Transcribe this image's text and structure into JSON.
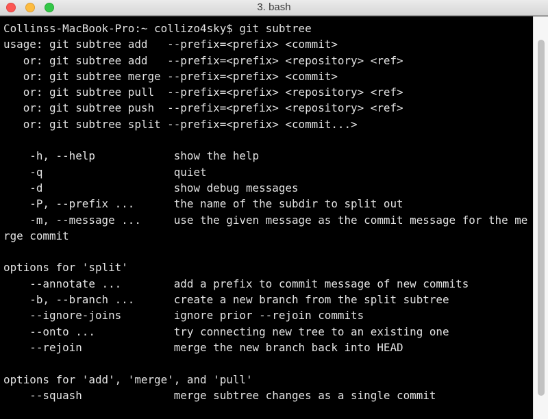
{
  "window": {
    "title": "3. bash",
    "buttons": [
      {
        "name": "close",
        "color": "#fc5753"
      },
      {
        "name": "minimize",
        "color": "#fdbc40"
      },
      {
        "name": "zoom",
        "color": "#33c748"
      }
    ]
  },
  "terminal": {
    "background": "#000000",
    "foreground": "#e2e2e2",
    "lines": [
      "Collinss-MacBook-Pro:~ collizo4sky$ git subtree",
      "usage: git subtree add   --prefix=<prefix> <commit>",
      "   or: git subtree add   --prefix=<prefix> <repository> <ref>",
      "   or: git subtree merge --prefix=<prefix> <commit>",
      "   or: git subtree pull  --prefix=<prefix> <repository> <ref>",
      "   or: git subtree push  --prefix=<prefix> <repository> <ref>",
      "   or: git subtree split --prefix=<prefix> <commit...>",
      "",
      "    -h, --help            show the help",
      "    -q                    quiet",
      "    -d                    show debug messages",
      "    -P, --prefix ...      the name of the subdir to split out",
      "    -m, --message ...     use the given message as the commit message for the me",
      "rge commit",
      "",
      "options for 'split'",
      "    --annotate ...        add a prefix to commit message of new commits",
      "    -b, --branch ...      create a new branch from the split subtree",
      "    --ignore-joins        ignore prior --rejoin commits",
      "    --onto ...            try connecting new tree to an existing one",
      "    --rejoin              merge the new branch back into HEAD",
      "",
      "options for 'add', 'merge', and 'pull'",
      "    --squash              merge subtree changes as a single commit"
    ]
  },
  "scrollbar": {
    "visible_fraction": 0.91,
    "scroll_position": 0.5
  }
}
